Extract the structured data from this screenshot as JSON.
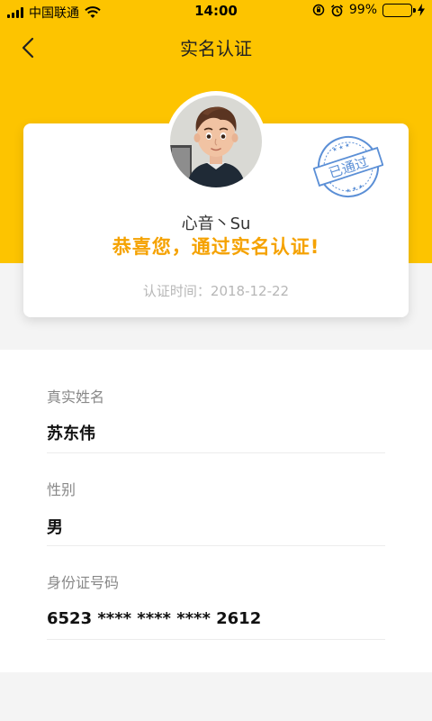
{
  "status_bar": {
    "carrier": "中国联通",
    "time": "14:00",
    "battery_percent": "99%",
    "battery_level": 0.99,
    "icons": [
      "signal-icon",
      "wifi-icon",
      "rotation-lock-icon",
      "alarm-icon",
      "battery-icon",
      "charging-icon"
    ]
  },
  "nav": {
    "back_icon": "chevron-left-icon",
    "title": "实名认证"
  },
  "card": {
    "nickname": "心音丶Su",
    "congrats": "恭喜您，通过实名认证!",
    "verify_date": "认证时间：2018-12-22",
    "stamp_text": "已通过"
  },
  "fields": [
    {
      "label": "真实姓名",
      "value": "苏东伟"
    },
    {
      "label": "性别",
      "value": "男"
    },
    {
      "label": "身份证号码",
      "value": "6523 **** **** **** 2612"
    }
  ],
  "colors": {
    "brand_yellow": "#fdc400",
    "congrats_orange": "#f5a200",
    "stamp_blue": "#5b8fd6",
    "battery_green": "#4cd964"
  }
}
